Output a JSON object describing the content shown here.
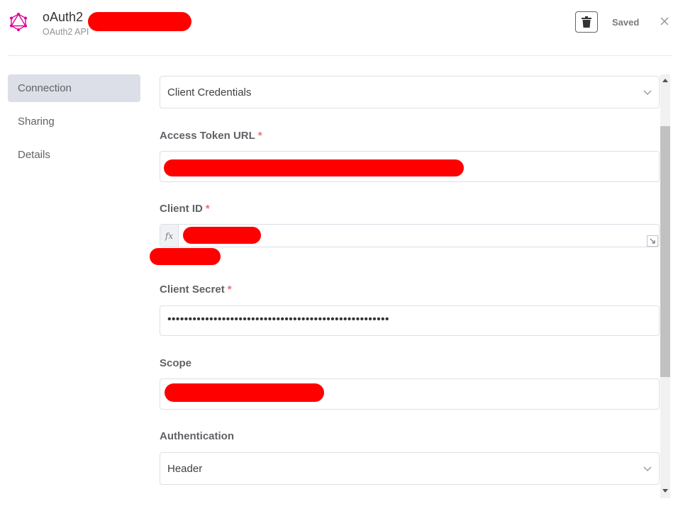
{
  "header": {
    "title": "oAuth2",
    "subtitle": "OAuth2 API",
    "saved_label": "Saved",
    "logo_icon": "graphql-icon",
    "delete_icon": "trash-icon",
    "close_icon": "close-icon"
  },
  "sidebar": {
    "items": [
      {
        "label": "Connection",
        "active": true
      },
      {
        "label": "Sharing",
        "active": false
      },
      {
        "label": "Details",
        "active": false
      }
    ]
  },
  "form": {
    "grant_type": {
      "value": "Client Credentials"
    },
    "access_token_url": {
      "label": "Access Token URL",
      "required": "*"
    },
    "client_id": {
      "label": "Client ID",
      "required": "*",
      "fx": "fx"
    },
    "client_secret": {
      "label": "Client Secret",
      "required": "*",
      "value": "•••••••••••••••••••••••••••••••••••••••••••••••••••••"
    },
    "scope": {
      "label": "Scope"
    },
    "authentication": {
      "label": "Authentication",
      "value": "Header"
    }
  },
  "colors": {
    "required": "#f56c6c",
    "active_nav": "#dcdfe8",
    "logo": "#e10098"
  }
}
